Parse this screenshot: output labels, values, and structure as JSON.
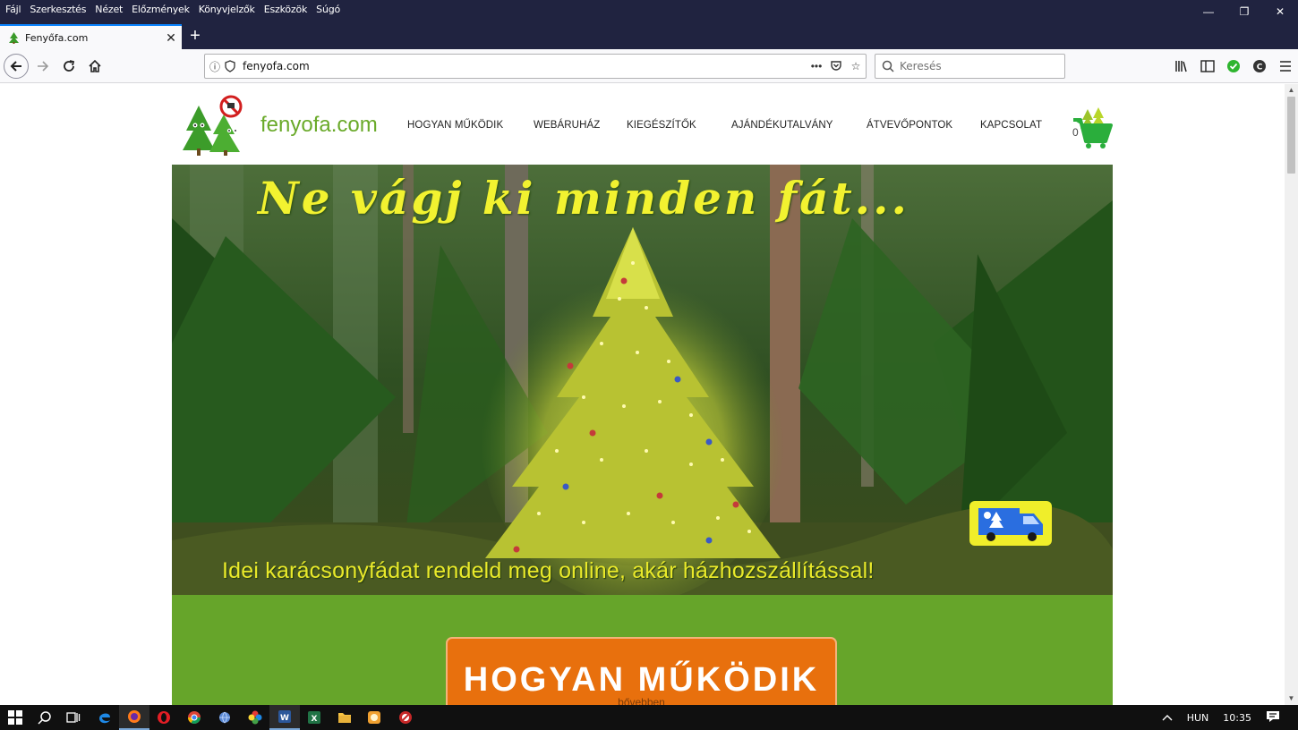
{
  "menu": [
    "Fájl",
    "Szerkesztés",
    "Nézet",
    "Előzmények",
    "Könyvjelzők",
    "Eszközök",
    "Súgó"
  ],
  "window_controls": {
    "minimize": "—",
    "restore": "❐",
    "close": "✕"
  },
  "tab": {
    "title": "Fenyőfa.com",
    "close": "✕",
    "new_tab": "+"
  },
  "nav": {
    "url": "fenyofa.com",
    "search_placeholder": "Keresés",
    "more": "•••"
  },
  "site": {
    "name": "fenyofa.com",
    "menu": [
      "HOGYAN MŰKÖDIK",
      "WEBÁRUHÁZ",
      "KIEGÉSZÍTŐK",
      "AJÁNDÉKUTALVÁNY",
      "ÁTVEVŐPONTOK",
      "KAPCSOLAT"
    ],
    "cart_count": "0"
  },
  "hero": {
    "headline": "Ne vágj ki minden fát...",
    "tagline": "Idei karácsonyfádat rendeld meg online, akár házhozszállítással!"
  },
  "how": {
    "title": "HOGYAN MŰKÖDIK",
    "more": "bővebben"
  },
  "tray": {
    "language": "HUN",
    "time": "10:35"
  },
  "colors": {
    "brand_green": "#6aaa2a",
    "band_green": "#66a52a",
    "button_orange": "#e8700d",
    "hero_yellow": "#f2f230",
    "browser_dark": "#202340"
  }
}
